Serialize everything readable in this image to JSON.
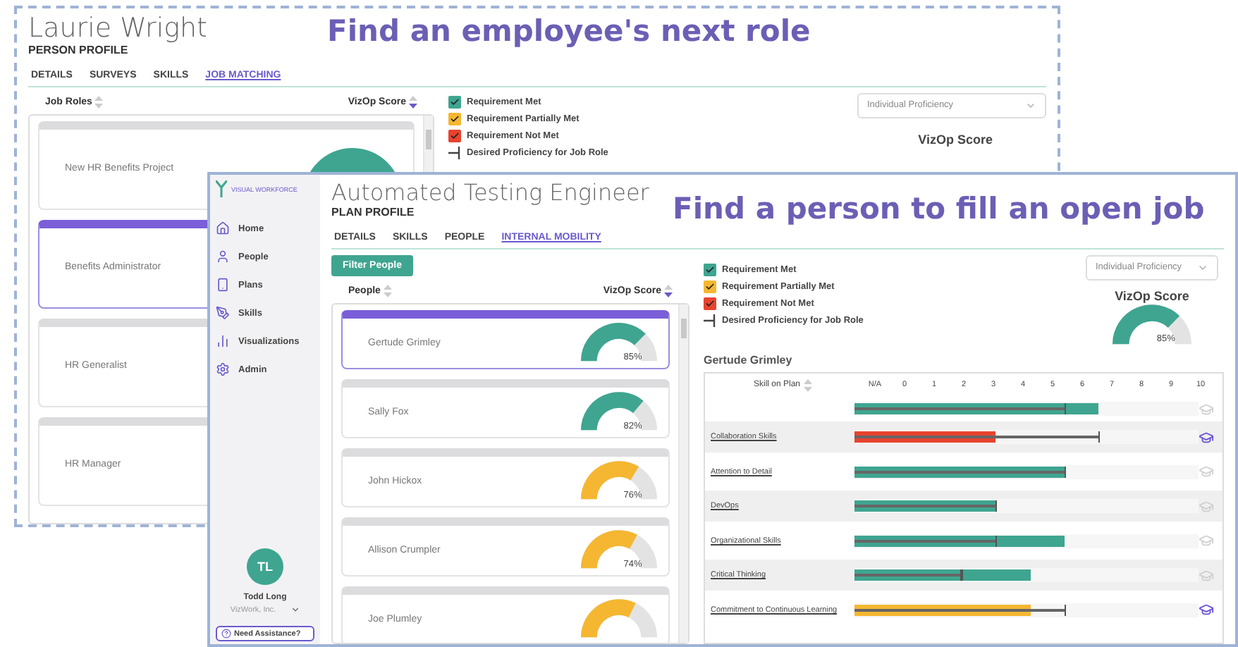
{
  "back_window": {
    "caption": "Find an employee's next role",
    "title": "Laurie Wright",
    "subtitle": "PERSON PROFILE",
    "tabs": [
      {
        "label": "DETAILS",
        "selected": false
      },
      {
        "label": "SURVEYS",
        "selected": false
      },
      {
        "label": "SKILLS",
        "selected": false
      },
      {
        "label": "JOB MATCHING",
        "selected": true
      }
    ],
    "list_header": {
      "name": "Job Roles",
      "score": "VizOp Score"
    },
    "roles": [
      {
        "name": "New HR Benefits Project",
        "selected": false,
        "color": "#3fa590"
      },
      {
        "name": "Benefits Administrator",
        "selected": true
      },
      {
        "name": "HR Generalist",
        "selected": false
      },
      {
        "name": "HR Manager",
        "selected": false
      }
    ],
    "legend": [
      {
        "kind": "box",
        "label": "Requirement Met",
        "color": "#3fa590"
      },
      {
        "kind": "box",
        "label": "Requirement Partially Met",
        "color": "#f5b731"
      },
      {
        "kind": "box",
        "label": "Requirement Not Met",
        "color": "#e8432f"
      },
      {
        "kind": "marker",
        "label": "Desired Proficiency for Job Role"
      }
    ],
    "dropdown": {
      "value": "Individual Proficiency"
    },
    "score_title": "VizOp Score"
  },
  "front_window": {
    "caption": "Find a person to fill an open job",
    "brand": "VISUAL WORKFORCE",
    "nav": [
      {
        "label": "Home",
        "kind": "home"
      },
      {
        "label": "People",
        "kind": "people"
      },
      {
        "label": "Plans",
        "kind": "plans"
      },
      {
        "label": "Skills",
        "kind": "skills"
      },
      {
        "label": "Visualizations",
        "kind": "charts"
      },
      {
        "label": "Admin",
        "kind": "admin"
      }
    ],
    "user": {
      "initials": "TL",
      "name": "Todd Long",
      "company": "VizWork, Inc."
    },
    "help": "Need Assistance?",
    "title": "Automated Testing Engineer",
    "subtitle": "PLAN PROFILE",
    "tabs": [
      {
        "label": "DETAILS",
        "selected": false
      },
      {
        "label": "SKILLS",
        "selected": false
      },
      {
        "label": "PEOPLE",
        "selected": false
      },
      {
        "label": "INTERNAL MOBILITY",
        "selected": true
      }
    ],
    "filter_button": "Filter People",
    "list_header": {
      "name": "People",
      "score": "VizOp Score"
    },
    "people": [
      {
        "name": "Gertude Grimley",
        "selected": true,
        "score": "85%",
        "level": 0.85,
        "color": "#3fa590"
      },
      {
        "name": "Sally Fox",
        "selected": false,
        "score": "82%",
        "level": 0.82,
        "color": "#3fa590"
      },
      {
        "name": "John Hickox",
        "selected": false,
        "score": "76%",
        "level": 0.76,
        "color": "#f5b731"
      },
      {
        "name": "Allison Crumpler",
        "selected": false,
        "score": "74%",
        "level": 0.74,
        "color": "#f5b731"
      },
      {
        "name": "Joe Plumley",
        "selected": false,
        "level": 0.72,
        "color": "#f5b731"
      }
    ],
    "legend": [
      {
        "kind": "box",
        "label": "Requirement Met",
        "color": "#3fa590"
      },
      {
        "kind": "box",
        "label": "Requirement Partially Met",
        "color": "#f5b731"
      },
      {
        "kind": "box",
        "label": "Requirement Not Met",
        "color": "#e8432f"
      },
      {
        "kind": "marker",
        "label": "Desired Proficiency for Job Role"
      }
    ],
    "dropdown": {
      "value": "Individual Proficiency"
    },
    "score": {
      "title": "VizOp Score",
      "value": "85%",
      "level": 0.85,
      "color": "#3fa590"
    },
    "person_name": "Gertude Grimley",
    "skills_table": {
      "header": "Skill on Plan",
      "scale": [
        "N/A",
        "0",
        "1",
        "2",
        "3",
        "4",
        "5",
        "6",
        "7",
        "8",
        "9",
        "10"
      ],
      "rows": [
        {
          "actual": {
            "level": 0.71
          },
          "desired": {
            "level": 0.61
          },
          "color": "#3fa590",
          "learning": false
        },
        {
          "skill": "Collaboration Skills",
          "actual": {
            "level": 0.41
          },
          "desired": {
            "level": 0.71
          },
          "color": "#e8432f",
          "learning": true
        },
        {
          "skill": "Attention to Detail",
          "actual": {
            "level": 0.61
          },
          "desired": {
            "level": 0.61
          },
          "color": "#3fa590",
          "learning": false
        },
        {
          "skill": "DevOps",
          "actual": {
            "level": 0.41
          },
          "desired": {
            "level": 0.41
          },
          "color": "#3fa590",
          "learning": false
        },
        {
          "skill": "Organizational Skills",
          "actual": {
            "level": 0.61
          },
          "desired": {
            "level": 0.41
          },
          "color": "#3fa590",
          "learning": false
        },
        {
          "skill": "Critical Thinking",
          "actual": {
            "level": 0.51
          },
          "desired": {
            "level": 0.31
          },
          "color": "#3fa590",
          "learning": false
        },
        {
          "skill": "Commitment to Continuous Learning",
          "actual": {
            "level": 0.51
          },
          "desired": {
            "level": 0.61
          },
          "color": "#f5b731",
          "learning": true
        }
      ]
    }
  }
}
